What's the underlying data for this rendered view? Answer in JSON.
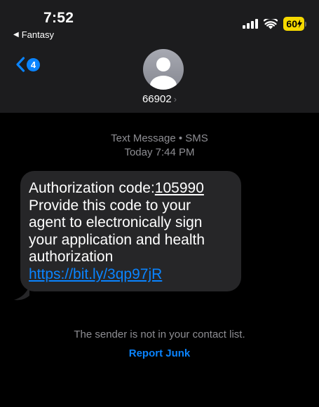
{
  "status_bar": {
    "time": "7:52",
    "back_app": "Fantasy",
    "battery": "60"
  },
  "header": {
    "back_badge": "4",
    "contact": "66902"
  },
  "message": {
    "type": "Text Message • SMS",
    "timestamp": "Today 7:44 PM",
    "text_prefix": "Authorization code:",
    "code": "105990",
    "text_body": " Provide this code to your agent to electronically sign your application and health authorization ",
    "link": "https://bit.ly/3qp97jR"
  },
  "footer": {
    "notice": "The sender is not in your contact list.",
    "report_junk": "Report Junk"
  },
  "colors": {
    "background": "#000000",
    "header_bg": "#1c1c1e",
    "bubble_bg": "#262628",
    "accent": "#0a84ff",
    "battery": "#f5d800",
    "secondary_text": "#8e8e93"
  }
}
